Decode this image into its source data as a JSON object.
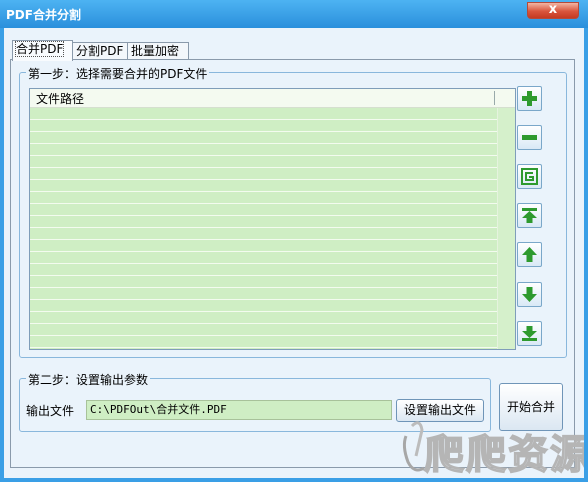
{
  "window": {
    "title": "PDF合并分割",
    "close_label": "x"
  },
  "tabs": [
    {
      "label": "合并PDF",
      "active": true
    },
    {
      "label": "分割PDF",
      "active": false
    },
    {
      "label": "批量加密",
      "active": false
    }
  ],
  "step1": {
    "title": "第一步：选择需要合并的PDF文件",
    "list": {
      "column_header": "文件路径",
      "rows": []
    },
    "side_buttons": [
      {
        "icon": "plus-icon"
      },
      {
        "icon": "minus-icon"
      },
      {
        "icon": "refresh-icon"
      },
      {
        "icon": "move-top-icon"
      },
      {
        "icon": "move-up-icon"
      },
      {
        "icon": "move-down-icon"
      },
      {
        "icon": "move-bottom-icon"
      }
    ]
  },
  "step2": {
    "title": "第二步：设置输出参数",
    "output_label": "输出文件",
    "output_value": "C:\\PDFOut\\合并文件.PDF",
    "set_output_button": "设置输出文件"
  },
  "start_button": "开始合并",
  "watermark": {
    "text": "爬爬资源"
  },
  "colors": {
    "accent": "#3a9fe6",
    "list_bg": "#cfeec4",
    "icon_green": "#2e9a2e"
  }
}
